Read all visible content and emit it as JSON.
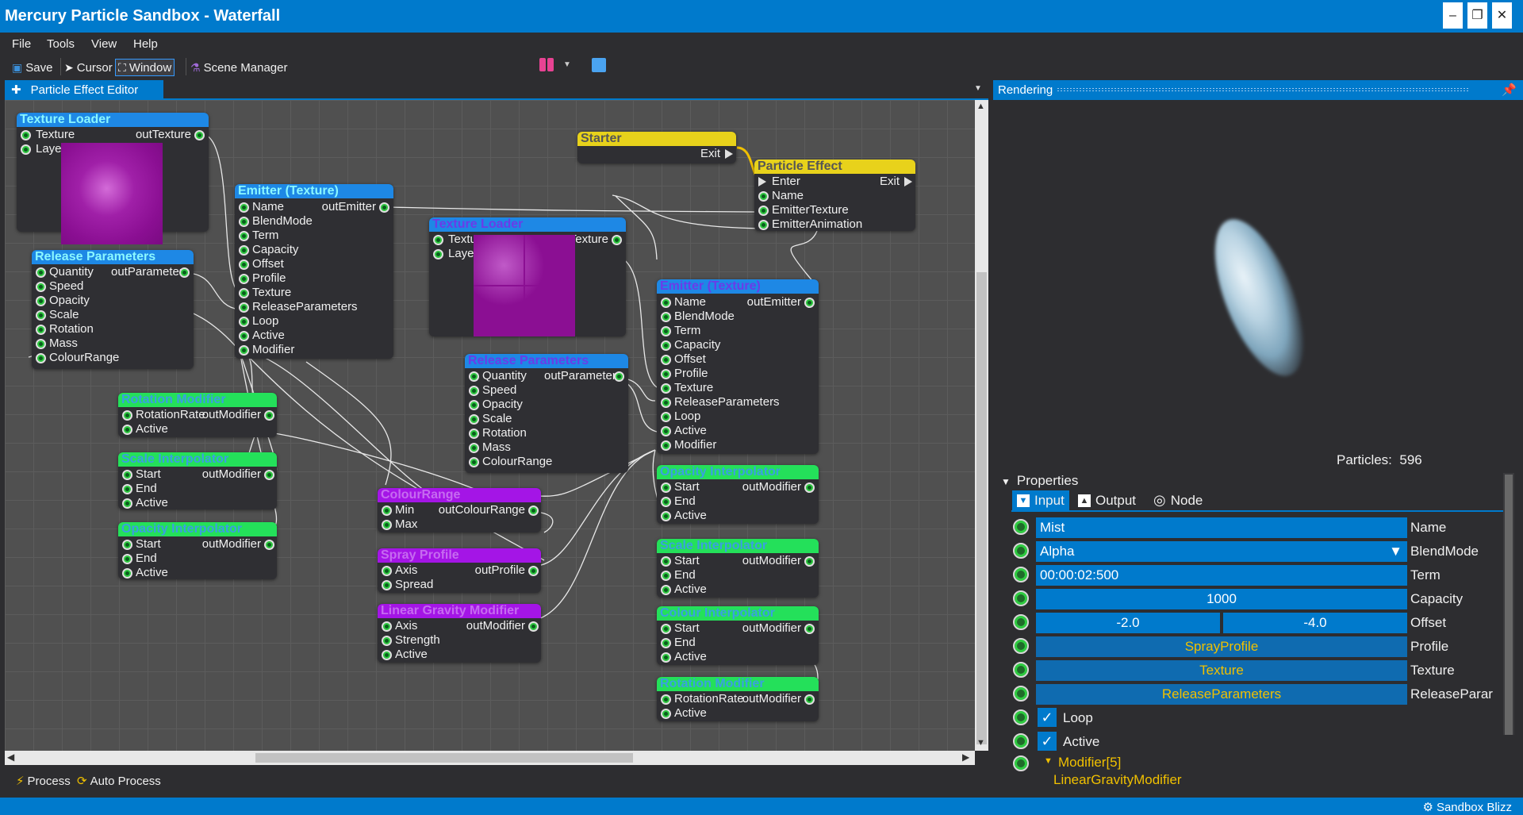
{
  "window": {
    "title": "Mercury Particle Sandbox - Waterfall"
  },
  "menu": [
    "File",
    "Tools",
    "View",
    "Help"
  ],
  "toolbar": {
    "save": "Save",
    "cursor": "Cursor",
    "window": "Window",
    "scene_manager": "Scene Manager"
  },
  "editor": {
    "tab": "Particle Effect Editor",
    "nodes": {
      "texture_loader_1": {
        "title": "Texture Loader",
        "in": [
          "Texture",
          "Layer"
        ],
        "out": "outTexture"
      },
      "emitter_1": {
        "title": "Emitter (Texture)",
        "out": "outEmitter",
        "in": [
          "Name",
          "BlendMode",
          "Term",
          "Capacity",
          "Offset",
          "Profile",
          "Texture",
          "ReleaseParameters",
          "Loop",
          "Active",
          "Modifier"
        ]
      },
      "release_1": {
        "title": "Release Parameters",
        "out": "outParameters",
        "in": [
          "Quantity",
          "Speed",
          "Opacity",
          "Scale",
          "Rotation",
          "Mass",
          "ColourRange"
        ]
      },
      "rotation_mod_1": {
        "title": "Rotation Modifier",
        "out": "outModifier",
        "in": [
          "RotationRate",
          "Active"
        ]
      },
      "scale_interp_1": {
        "title": "Scale Interpolator",
        "out": "outModifier",
        "in": [
          "Start",
          "End",
          "Active"
        ]
      },
      "opacity_interp_1": {
        "title": "Opacity Interpolator",
        "out": "outModifier",
        "in": [
          "Start",
          "End",
          "Active"
        ]
      },
      "starter": {
        "title": "Starter",
        "exit": "Exit"
      },
      "particle_effect": {
        "title": "Particle Effect",
        "enter": "Enter",
        "exit": "Exit",
        "in": [
          "Name",
          "EmitterTexture",
          "EmitterAnimation"
        ]
      },
      "texture_loader_2": {
        "title": "Texture Loader",
        "in": [
          "Texture",
          "Layer"
        ],
        "out": "outTexture"
      },
      "release_2": {
        "title": "Release Parameters",
        "out": "outParameters",
        "in": [
          "Quantity",
          "Speed",
          "Opacity",
          "Scale",
          "Rotation",
          "Mass",
          "ColourRange"
        ]
      },
      "colour_range": {
        "title": "ColourRange",
        "out": "outColourRange",
        "in": [
          "Min",
          "Max"
        ]
      },
      "spray_profile": {
        "title": "Spray Profile",
        "out": "outProfile",
        "in": [
          "Axis",
          "Spread"
        ]
      },
      "linear_gravity": {
        "title": "Linear Gravity Modifier",
        "out": "outModifier",
        "in": [
          "Axis",
          "Strength",
          "Active"
        ]
      },
      "emitter_2": {
        "title": "Emitter (Texture)",
        "out": "outEmitter",
        "in": [
          "Name",
          "BlendMode",
          "Term",
          "Capacity",
          "Offset",
          "Profile",
          "Texture",
          "ReleaseParameters",
          "Loop",
          "Active",
          "Modifier"
        ]
      },
      "opacity_interp_2": {
        "title": "Opacity Interpolator",
        "out": "outModifier",
        "in": [
          "Start",
          "End",
          "Active"
        ]
      },
      "scale_interp_2": {
        "title": "Scale Interpolator",
        "out": "outModifier",
        "in": [
          "Start",
          "End",
          "Active"
        ]
      },
      "colour_interp": {
        "title": "Colour Interpolator",
        "out": "outModifier",
        "in": [
          "Start",
          "End",
          "Active"
        ]
      },
      "rotation_mod_2": {
        "title": "Rotation Modifier",
        "out": "outModifier",
        "in": [
          "RotationRate",
          "Active"
        ]
      }
    }
  },
  "bottom": {
    "process": "Process",
    "auto_process": "Auto Process"
  },
  "rendering": {
    "tab": "Rendering",
    "particles_label": "Particles:",
    "particles_count": "596"
  },
  "properties": {
    "header": "Properties",
    "tabs": [
      "Input",
      "Output",
      "Node"
    ],
    "name": {
      "value": "Mist",
      "label": "Name"
    },
    "blendmode": {
      "value": "Alpha",
      "label": "BlendMode"
    },
    "term": {
      "value": "00:00:02:500",
      "label": "Term"
    },
    "capacity": {
      "value": "1000",
      "label": "Capacity"
    },
    "offset": {
      "x": "-2.0",
      "y": "-4.0",
      "label": "Offset"
    },
    "profile": {
      "value": "SprayProfile",
      "label": "Profile"
    },
    "texture": {
      "value": "Texture",
      "label": "Texture"
    },
    "release": {
      "value": "ReleaseParameters",
      "label": "ReleaseParar"
    },
    "loop": {
      "label": "Loop",
      "checked": true
    },
    "active": {
      "label": "Active",
      "checked": true
    },
    "modifier": {
      "label": "Modifier[5]",
      "first": "LinearGravityModifier"
    }
  },
  "status": {
    "text": "Sandbox Blizz"
  },
  "colors": {
    "accent": "#007acc",
    "node_blue": "#1e88e5",
    "node_green": "#24e05a",
    "node_purple": "#a415e6",
    "node_yellow": "#e8d21b",
    "orange_text": "#f0c000"
  }
}
